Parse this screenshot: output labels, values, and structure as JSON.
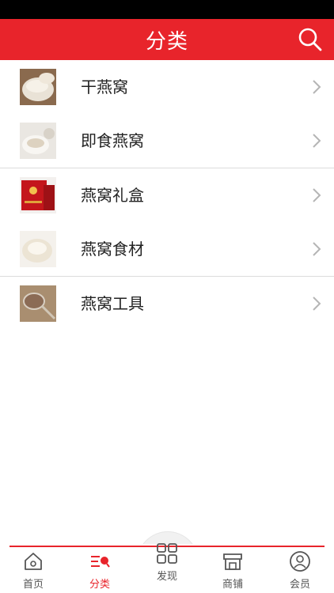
{
  "header": {
    "title": "分类"
  },
  "categories": [
    {
      "label": "干燕窝"
    },
    {
      "label": "即食燕窝"
    },
    {
      "label": "燕窝礼盒"
    },
    {
      "label": "燕窝食材"
    },
    {
      "label": "燕窝工具"
    }
  ],
  "tabbar": {
    "tabs": [
      {
        "label": "首页",
        "icon": "home-icon"
      },
      {
        "label": "分类",
        "icon": "category-icon",
        "active": true
      },
      {
        "label": "发现",
        "icon": "grid-icon"
      },
      {
        "label": "商铺",
        "icon": "shop-icon"
      },
      {
        "label": "会员",
        "icon": "user-icon"
      }
    ]
  },
  "colors": {
    "accent": "#e8242b"
  }
}
